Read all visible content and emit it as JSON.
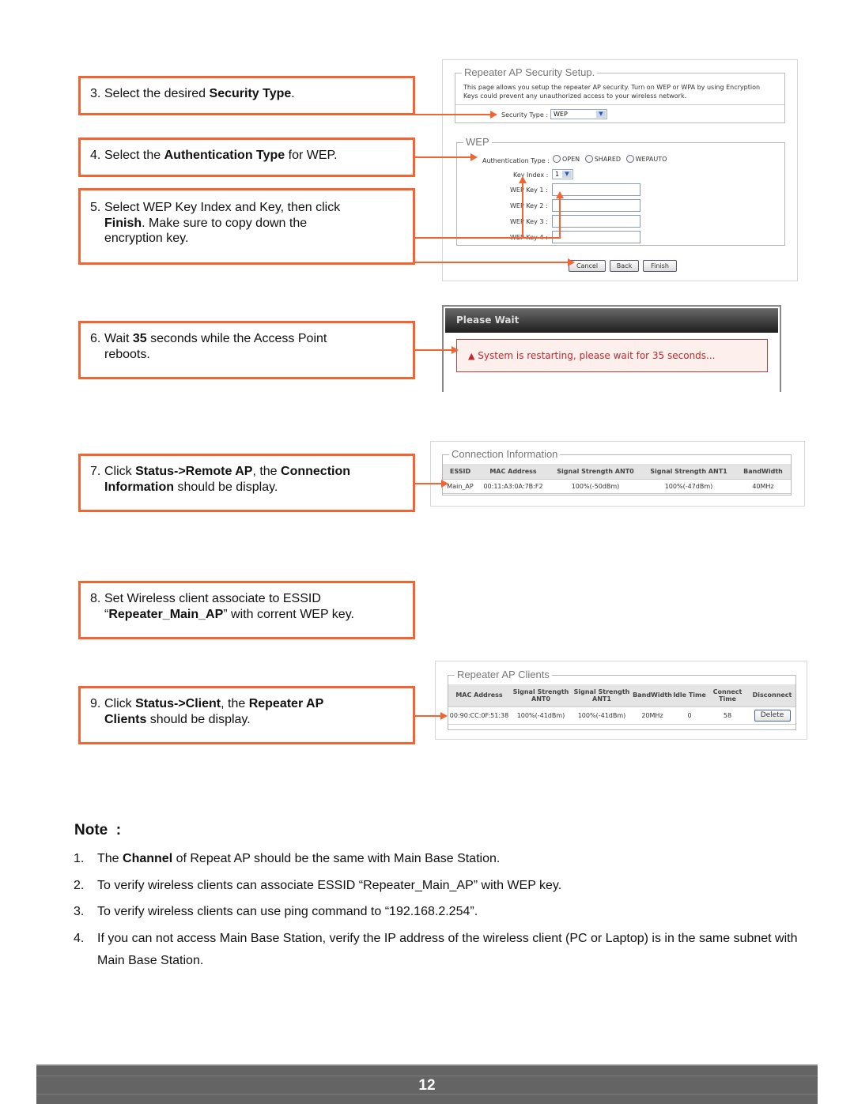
{
  "steps": [
    {
      "num": "3.",
      "parts": [
        "Select the desired ",
        "Security Type",
        "."
      ]
    },
    {
      "num": "4.",
      "parts": [
        "Select the ",
        "Authentication Type",
        " for WEP."
      ]
    },
    {
      "num": "5.",
      "parts": [
        "Select WEP Key Index and Key, then click ",
        "Finish",
        ". Make sure to copy down the encryption key."
      ]
    },
    {
      "num": "6.",
      "parts": [
        "Wait ",
        "35",
        " seconds while the Access Point reboots."
      ]
    },
    {
      "num": "7.",
      "parts": [
        "Click ",
        "Status->Remote AP",
        ", the ",
        "Connection Information",
        " should be display."
      ]
    },
    {
      "num": "8.",
      "parts": [
        "Set Wireless client associate to ESSID “",
        "Repeater_Main_AP",
        "” with corrent WEP key."
      ]
    },
    {
      "num": "9.",
      "parts": [
        "Click ",
        "Status->Client",
        ", the ",
        "Repeater AP Clients",
        " should be display."
      ]
    }
  ],
  "security_setup": {
    "legend": "Repeater AP Security Setup.",
    "description": "This page allows you setup the repeater AP security. Turn on WEP or WPA by using Encryption Keys could prevent any unauthorized access to your wireless network.",
    "security_type_label": "Security Type :",
    "security_type_value": "WEP",
    "wep_legend": "WEP",
    "auth_type_label": "Authentication Type :",
    "auth_options": [
      "OPEN",
      "SHARED",
      "WEPAUTO"
    ],
    "key_index_label": "Key Index :",
    "key_index_value": "1",
    "wep_keys": [
      {
        "label": "WEP Key 1 :",
        "value": ""
      },
      {
        "label": "WEP Key 2 :",
        "value": ""
      },
      {
        "label": "WEP Key 3 :",
        "value": ""
      },
      {
        "label": "WEP Key 4 :",
        "value": ""
      }
    ],
    "buttons": {
      "cancel": "Cancel",
      "back": "Back",
      "finish": "Finish"
    }
  },
  "please_wait": {
    "title": "Please Wait",
    "message": "System is restarting, please wait for 35 seconds..."
  },
  "connection_info": {
    "legend": "Connection Information",
    "headers": [
      "ESSID",
      "MAC Address",
      "Signal Strength ANT0",
      "Signal Strength ANT1",
      "BandWidth"
    ],
    "rows": [
      [
        "Main_AP",
        "00:11:A3:0A:7B:F2",
        "100%(-50dBm)",
        "100%(-47dBm)",
        "40MHz"
      ]
    ]
  },
  "repeater_clients": {
    "legend": "Repeater AP Clients",
    "headers": [
      "MAC Address",
      "Signal Strength ANT0",
      "Signal Strength ANT1",
      "BandWidth",
      "Idle Time",
      "Connect Time",
      "Disconnect"
    ],
    "rows": [
      [
        "00:90:CC:0F:51:38",
        "100%(-41dBm)",
        "100%(-41dBm)",
        "20MHz",
        "0",
        "58"
      ]
    ],
    "delete_label": "Delete"
  },
  "note": {
    "title": "Note  :",
    "items": [
      {
        "num": "1.",
        "parts": [
          "The ",
          "Channel",
          " of Repeat AP should be the same with Main Base Station."
        ]
      },
      {
        "num": "2.",
        "parts": [
          "To verify wireless clients can associate ESSID “Repeater_Main_AP” with WEP key."
        ]
      },
      {
        "num": "3.",
        "parts": [
          "To verify wireless clients can use ping command to “192.168.2.254”."
        ]
      },
      {
        "num": "4.",
        "parts": [
          "If you can not access Main Base Station, verify the IP address of the wireless client (PC or Laptop) is in the same subnet with Main Base Station."
        ]
      }
    ]
  },
  "footer": {
    "page_number": "12"
  },
  "colors": {
    "accent": "#f26532",
    "footer": "#646464",
    "alert_text": "#c0282d"
  }
}
